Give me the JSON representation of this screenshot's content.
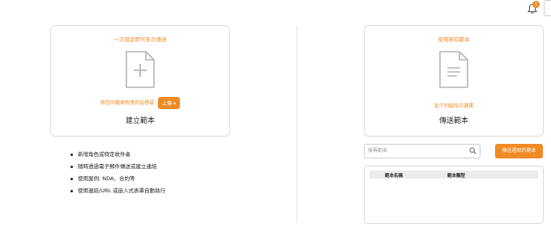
{
  "header": {
    "notification_count": "1"
  },
  "create_card": {
    "subtitle": "一次設定即可多次傳送",
    "upload_prompt": "將您的檔案拖曳到這裡或",
    "upload_button": "上傳",
    "upload_icon": "chevron-down-icon",
    "title": "建立範本",
    "icon": "document-plus-icon"
  },
  "template_card": {
    "subtitle": "使用現有範本",
    "hint": "從下列區段中選擇",
    "title": "傳送範本",
    "icon": "document-lines-icon"
  },
  "features": [
    "新增角色或特定收件者",
    "隨時透過電子郵件傳送或建立連結",
    "使用案例: NDA、合約等",
    "使用連結/URL 或嵌入式表單自動執行"
  ],
  "template_search": {
    "placeholder": "搜尋範本",
    "value": ""
  },
  "send_selected_button": "傳送選取的範本",
  "template_table": {
    "columns": [
      "範本名稱",
      "範本類型"
    ],
    "rows": []
  },
  "colors": {
    "accent": "#f08a24",
    "border": "#dcdcdc",
    "icon_gray": "#b5b5b5"
  }
}
